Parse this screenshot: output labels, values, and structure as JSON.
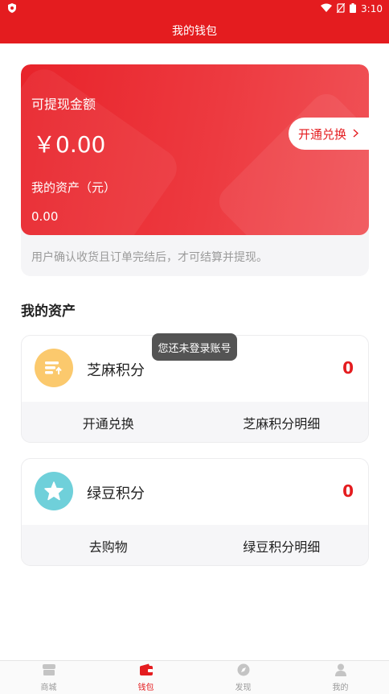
{
  "status_bar": {
    "time": "3:10"
  },
  "header": {
    "title": "我的钱包"
  },
  "wallet_card": {
    "withdraw_label": "可提现金额",
    "withdraw_amount": "￥0.00",
    "exchange_button": "开通兑换",
    "asset_label": "我的资产（元）",
    "asset_value": "0.00",
    "note": "用户确认收货且订单完结后，才可结算并提现。"
  },
  "assets_section": {
    "title": "我的资产"
  },
  "sesame_card": {
    "name": "芝麻积分",
    "value": "0",
    "icon": "sesame-points-icon",
    "icon_color": "#fbc96d",
    "actions": [
      "开通兑换",
      "芝麻积分明细"
    ]
  },
  "mungbean_card": {
    "name": "绿豆积分",
    "value": "0",
    "icon": "star-icon",
    "icon_color": "#6fd0da",
    "actions": [
      "去购物",
      "绿豆积分明细"
    ]
  },
  "toast": {
    "text": "您还未登录账号"
  },
  "tab_bar": {
    "items": [
      {
        "label": "商城",
        "icon": "store-icon"
      },
      {
        "label": "钱包",
        "icon": "wallet-icon"
      },
      {
        "label": "发现",
        "icon": "compass-icon"
      },
      {
        "label": "我的",
        "icon": "user-icon"
      }
    ],
    "active_index": 1
  },
  "colors": {
    "brand_red": "#e41c1f",
    "gray_text": "#9a9a9a"
  }
}
